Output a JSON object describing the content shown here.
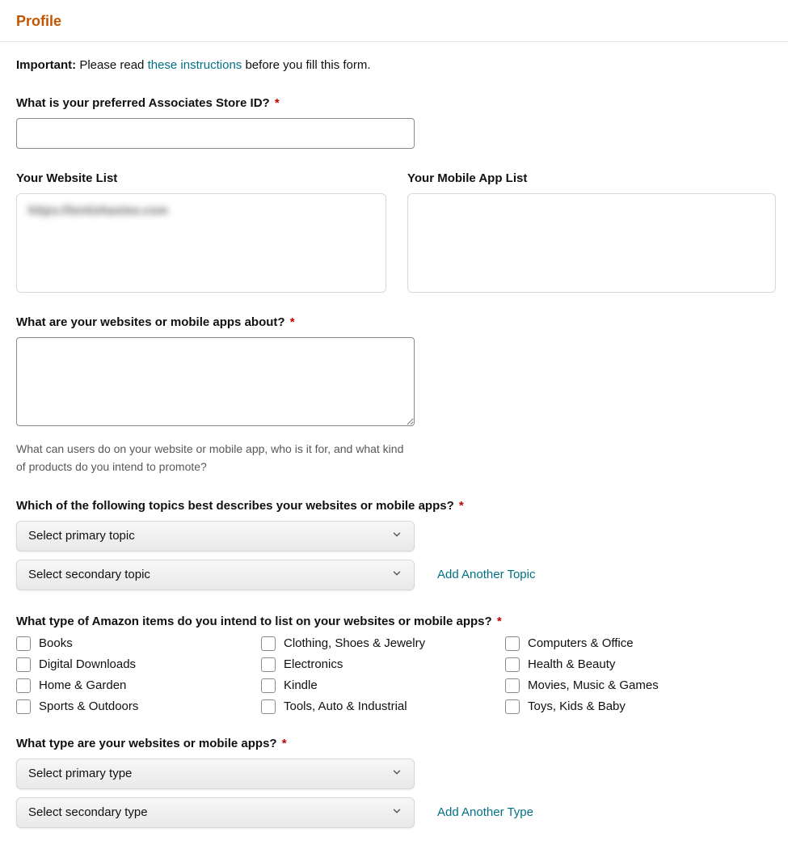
{
  "header": {
    "title": "Profile"
  },
  "instructions": {
    "important_label": "Important:",
    "before_link": " Please read ",
    "link_text": "these instructions",
    "after_link": " before you fill this form."
  },
  "store_id": {
    "label": "What is your preferred Associates Store ID? ",
    "value": ""
  },
  "website_list": {
    "label": "Your Website List",
    "content": "https://tentishaxtee.com"
  },
  "mobile_list": {
    "label": "Your Mobile App List",
    "content": ""
  },
  "about": {
    "label": "What are your websites or mobile apps about? ",
    "value": "",
    "help": "What can users do on your website or mobile app, who is it for, and what kind of products do you intend to promote?"
  },
  "topics": {
    "label": "Which of the following topics best describes your websites or mobile apps? ",
    "primary_placeholder": "Select primary topic",
    "secondary_placeholder": "Select secondary topic",
    "add_link": "Add Another Topic"
  },
  "items": {
    "label": "What type of Amazon items do you intend to list on your websites or mobile apps? ",
    "col1": [
      "Books",
      "Digital Downloads",
      "Home & Garden",
      "Sports & Outdoors"
    ],
    "col2": [
      "Clothing, Shoes & Jewelry",
      "Electronics",
      "Kindle",
      "Tools, Auto & Industrial"
    ],
    "col3": [
      "Computers & Office",
      "Health & Beauty",
      "Movies, Music & Games",
      "Toys, Kids & Baby"
    ]
  },
  "types": {
    "label": "What type are your websites or mobile apps? ",
    "primary_placeholder": "Select primary type",
    "secondary_placeholder": "Select secondary type",
    "add_link": "Add Another Type"
  }
}
